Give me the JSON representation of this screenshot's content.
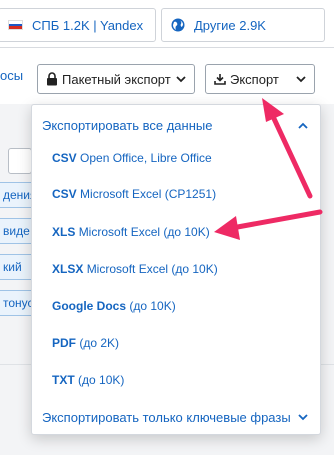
{
  "regions": [
    {
      "label": "СПБ 1.2K | Yandex",
      "icon": "russia-flag-icon"
    },
    {
      "label": "Другие 2.9K",
      "icon": "globe-icon"
    }
  ],
  "toolbar": {
    "left_cut_text": "осы",
    "batch_export_label": "Пакетный экспорт",
    "export_label": "Экспорт"
  },
  "background": {
    "chips": [
      "дения",
      "виде",
      "кий",
      "тонус"
    ]
  },
  "dropdown": {
    "header": "Экспортировать все данные",
    "items": [
      {
        "format": "CSV",
        "desc": "Open Office, Libre Office"
      },
      {
        "format": "CSV",
        "desc": "Microsoft Excel (CP1251)"
      },
      {
        "format": "XLS",
        "desc": "Microsoft Excel (до 10K)"
      },
      {
        "format": "XLSX",
        "desc": "Microsoft Excel (до 10K)"
      },
      {
        "format": "Google Docs",
        "desc": "(до 10K)"
      },
      {
        "format": "PDF",
        "desc": "(до 2K)"
      },
      {
        "format": "TXT",
        "desc": "(до 10K)"
      }
    ],
    "footer": "Экспортировать только ключевые фразы"
  },
  "colors": {
    "link": "#1565c0",
    "annotation_arrow": "#ee2a64"
  }
}
